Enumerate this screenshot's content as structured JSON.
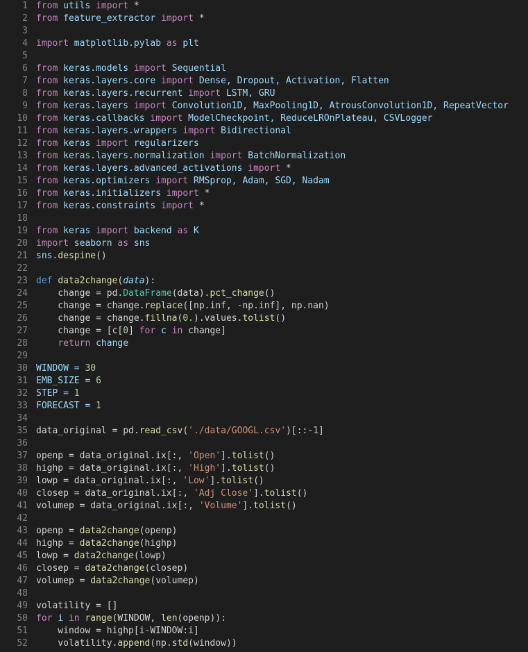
{
  "line_count": 52,
  "lines": [
    {
      "n": 1,
      "tokens": [
        {
          "t": "from ",
          "c": "kw"
        },
        {
          "t": "utils ",
          "c": "var"
        },
        {
          "t": "import ",
          "c": "kw"
        },
        {
          "t": "*",
          "c": "op"
        }
      ]
    },
    {
      "n": 2,
      "tokens": [
        {
          "t": "from ",
          "c": "kw"
        },
        {
          "t": "feature_extractor ",
          "c": "var"
        },
        {
          "t": "import ",
          "c": "kw"
        },
        {
          "t": "*",
          "c": "op"
        }
      ]
    },
    {
      "n": 3,
      "tokens": []
    },
    {
      "n": 4,
      "tokens": [
        {
          "t": "import ",
          "c": "kw"
        },
        {
          "t": "matplotlib.pylab ",
          "c": "var"
        },
        {
          "t": "as ",
          "c": "kw"
        },
        {
          "t": "plt",
          "c": "var"
        }
      ]
    },
    {
      "n": 5,
      "tokens": []
    },
    {
      "n": 6,
      "tokens": [
        {
          "t": "from ",
          "c": "kw"
        },
        {
          "t": "keras.models ",
          "c": "var"
        },
        {
          "t": "import ",
          "c": "kw"
        },
        {
          "t": "Sequential",
          "c": "var"
        }
      ]
    },
    {
      "n": 7,
      "tokens": [
        {
          "t": "from ",
          "c": "kw"
        },
        {
          "t": "keras.layers.core ",
          "c": "var"
        },
        {
          "t": "import ",
          "c": "kw"
        },
        {
          "t": "Dense, Dropout, Activation, Flatten",
          "c": "var"
        }
      ]
    },
    {
      "n": 8,
      "tokens": [
        {
          "t": "from ",
          "c": "kw"
        },
        {
          "t": "keras.layers.recurrent ",
          "c": "var"
        },
        {
          "t": "import ",
          "c": "kw"
        },
        {
          "t": "LSTM, GRU",
          "c": "var"
        }
      ]
    },
    {
      "n": 9,
      "tokens": [
        {
          "t": "from ",
          "c": "kw"
        },
        {
          "t": "keras.layers ",
          "c": "var"
        },
        {
          "t": "import ",
          "c": "kw"
        },
        {
          "t": "Convolution1D, MaxPooling1D, AtrousConvolution1D, RepeatVector",
          "c": "var"
        }
      ]
    },
    {
      "n": 10,
      "tokens": [
        {
          "t": "from ",
          "c": "kw"
        },
        {
          "t": "keras.callbacks ",
          "c": "var"
        },
        {
          "t": "import ",
          "c": "kw"
        },
        {
          "t": "ModelCheckpoint, ReduceLROnPlateau, CSVLogger",
          "c": "var"
        }
      ]
    },
    {
      "n": 11,
      "tokens": [
        {
          "t": "from ",
          "c": "kw"
        },
        {
          "t": "keras.layers.wrappers ",
          "c": "var"
        },
        {
          "t": "import ",
          "c": "kw"
        },
        {
          "t": "Bidirectional",
          "c": "var"
        }
      ]
    },
    {
      "n": 12,
      "tokens": [
        {
          "t": "from ",
          "c": "kw"
        },
        {
          "t": "keras ",
          "c": "var"
        },
        {
          "t": "import ",
          "c": "kw"
        },
        {
          "t": "regularizers",
          "c": "var"
        }
      ]
    },
    {
      "n": 13,
      "tokens": [
        {
          "t": "from ",
          "c": "kw"
        },
        {
          "t": "keras.layers.normalization ",
          "c": "var"
        },
        {
          "t": "import ",
          "c": "kw"
        },
        {
          "t": "BatchNormalization",
          "c": "var"
        }
      ]
    },
    {
      "n": 14,
      "tokens": [
        {
          "t": "from ",
          "c": "kw"
        },
        {
          "t": "keras.layers.advanced_activations ",
          "c": "var"
        },
        {
          "t": "import ",
          "c": "kw"
        },
        {
          "t": "*",
          "c": "op"
        }
      ]
    },
    {
      "n": 15,
      "tokens": [
        {
          "t": "from ",
          "c": "kw"
        },
        {
          "t": "keras.optimizers ",
          "c": "var"
        },
        {
          "t": "import ",
          "c": "kw"
        },
        {
          "t": "RMSprop, Adam, SGD, Nadam",
          "c": "var"
        }
      ]
    },
    {
      "n": 16,
      "tokens": [
        {
          "t": "from ",
          "c": "kw"
        },
        {
          "t": "keras.initializers ",
          "c": "var"
        },
        {
          "t": "import ",
          "c": "kw"
        },
        {
          "t": "*",
          "c": "op"
        }
      ]
    },
    {
      "n": 17,
      "tokens": [
        {
          "t": "from ",
          "c": "kw"
        },
        {
          "t": "keras.constraints ",
          "c": "var"
        },
        {
          "t": "import ",
          "c": "kw"
        },
        {
          "t": "*",
          "c": "op"
        }
      ]
    },
    {
      "n": 18,
      "tokens": []
    },
    {
      "n": 19,
      "tokens": [
        {
          "t": "from ",
          "c": "kw"
        },
        {
          "t": "keras ",
          "c": "var"
        },
        {
          "t": "import ",
          "c": "kw"
        },
        {
          "t": "backend ",
          "c": "var"
        },
        {
          "t": "as ",
          "c": "kw"
        },
        {
          "t": "K",
          "c": "var"
        }
      ]
    },
    {
      "n": 20,
      "tokens": [
        {
          "t": "import ",
          "c": "kw"
        },
        {
          "t": "seaborn ",
          "c": "var"
        },
        {
          "t": "as ",
          "c": "kw"
        },
        {
          "t": "sns",
          "c": "var"
        }
      ]
    },
    {
      "n": 21,
      "tokens": [
        {
          "t": "sns.",
          "c": "var"
        },
        {
          "t": "despine",
          "c": "fn"
        },
        {
          "t": "()",
          "c": "punc"
        }
      ]
    },
    {
      "n": 22,
      "tokens": []
    },
    {
      "n": 23,
      "tokens": [
        {
          "t": "def ",
          "c": "const"
        },
        {
          "t": "data2change",
          "c": "fn"
        },
        {
          "t": "(",
          "c": "punc"
        },
        {
          "t": "data",
          "c": "paramdef"
        },
        {
          "t": "):",
          "c": "punc"
        }
      ]
    },
    {
      "n": 24,
      "tokens": [
        {
          "t": "    change = pd.",
          "c": "op"
        },
        {
          "t": "DataFrame",
          "c": "type"
        },
        {
          "t": "(data).",
          "c": "op"
        },
        {
          "t": "pct_change",
          "c": "fn"
        },
        {
          "t": "()",
          "c": "punc"
        }
      ]
    },
    {
      "n": 25,
      "tokens": [
        {
          "t": "    change = change.",
          "c": "op"
        },
        {
          "t": "replace",
          "c": "fn"
        },
        {
          "t": "([np.inf, -np.inf], np.nan)",
          "c": "op"
        }
      ]
    },
    {
      "n": 26,
      "tokens": [
        {
          "t": "    change = change.",
          "c": "op"
        },
        {
          "t": "fillna",
          "c": "fn"
        },
        {
          "t": "(",
          "c": "punc"
        },
        {
          "t": "0.",
          "c": "num"
        },
        {
          "t": ").values.",
          "c": "op"
        },
        {
          "t": "tolist",
          "c": "fn"
        },
        {
          "t": "()",
          "c": "punc"
        }
      ]
    },
    {
      "n": 27,
      "tokens": [
        {
          "t": "    change = [c[",
          "c": "op"
        },
        {
          "t": "0",
          "c": "num"
        },
        {
          "t": "] ",
          "c": "op"
        },
        {
          "t": "for ",
          "c": "kw"
        },
        {
          "t": "c ",
          "c": "var"
        },
        {
          "t": "in ",
          "c": "kw"
        },
        {
          "t": "change]",
          "c": "op"
        }
      ]
    },
    {
      "n": 28,
      "tokens": [
        {
          "t": "    ",
          "c": "op"
        },
        {
          "t": "return ",
          "c": "kw"
        },
        {
          "t": "change",
          "c": "var"
        }
      ]
    },
    {
      "n": 29,
      "tokens": []
    },
    {
      "n": 30,
      "tokens": [
        {
          "t": "WINDOW = ",
          "c": "var"
        },
        {
          "t": "30",
          "c": "num"
        }
      ]
    },
    {
      "n": 31,
      "tokens": [
        {
          "t": "EMB_SIZE = ",
          "c": "var"
        },
        {
          "t": "6",
          "c": "num"
        }
      ]
    },
    {
      "n": 32,
      "tokens": [
        {
          "t": "STEP = ",
          "c": "var"
        },
        {
          "t": "1",
          "c": "num"
        }
      ]
    },
    {
      "n": 33,
      "tokens": [
        {
          "t": "FORECAST = ",
          "c": "var"
        },
        {
          "t": "1",
          "c": "num"
        }
      ]
    },
    {
      "n": 34,
      "tokens": []
    },
    {
      "n": 35,
      "tokens": [
        {
          "t": "data_original = pd.",
          "c": "op"
        },
        {
          "t": "read_csv",
          "c": "fn"
        },
        {
          "t": "(",
          "c": "punc"
        },
        {
          "t": "'./data/GOOGL.csv'",
          "c": "str"
        },
        {
          "t": ")[::-",
          "c": "op"
        },
        {
          "t": "1",
          "c": "num"
        },
        {
          "t": "]",
          "c": "op"
        }
      ]
    },
    {
      "n": 36,
      "tokens": []
    },
    {
      "n": 37,
      "tokens": [
        {
          "t": "openp = data_original.ix[:, ",
          "c": "op"
        },
        {
          "t": "'Open'",
          "c": "str"
        },
        {
          "t": "].",
          "c": "op"
        },
        {
          "t": "tolist",
          "c": "fn"
        },
        {
          "t": "()",
          "c": "punc"
        }
      ]
    },
    {
      "n": 38,
      "tokens": [
        {
          "t": "highp = data_original.ix[:, ",
          "c": "op"
        },
        {
          "t": "'High'",
          "c": "str"
        },
        {
          "t": "].",
          "c": "op"
        },
        {
          "t": "tolist",
          "c": "fn"
        },
        {
          "t": "()",
          "c": "punc"
        }
      ]
    },
    {
      "n": 39,
      "tokens": [
        {
          "t": "lowp = data_original.ix[:, ",
          "c": "op"
        },
        {
          "t": "'Low'",
          "c": "str"
        },
        {
          "t": "].",
          "c": "op"
        },
        {
          "t": "tolist",
          "c": "fn"
        },
        {
          "t": "()",
          "c": "punc"
        }
      ]
    },
    {
      "n": 40,
      "tokens": [
        {
          "t": "closep = data_original.ix[:, ",
          "c": "op"
        },
        {
          "t": "'Adj Close'",
          "c": "str"
        },
        {
          "t": "].",
          "c": "op"
        },
        {
          "t": "tolist",
          "c": "fn"
        },
        {
          "t": "()",
          "c": "punc"
        }
      ]
    },
    {
      "n": 41,
      "tokens": [
        {
          "t": "volumep = data_original.ix[:, ",
          "c": "op"
        },
        {
          "t": "'Volume'",
          "c": "str"
        },
        {
          "t": "].",
          "c": "op"
        },
        {
          "t": "tolist",
          "c": "fn"
        },
        {
          "t": "()",
          "c": "punc"
        }
      ]
    },
    {
      "n": 42,
      "tokens": []
    },
    {
      "n": 43,
      "tokens": [
        {
          "t": "openp = ",
          "c": "op"
        },
        {
          "t": "data2change",
          "c": "fn"
        },
        {
          "t": "(openp)",
          "c": "op"
        }
      ]
    },
    {
      "n": 44,
      "tokens": [
        {
          "t": "highp = ",
          "c": "op"
        },
        {
          "t": "data2change",
          "c": "fn"
        },
        {
          "t": "(highp)",
          "c": "op"
        }
      ]
    },
    {
      "n": 45,
      "tokens": [
        {
          "t": "lowp = ",
          "c": "op"
        },
        {
          "t": "data2change",
          "c": "fn"
        },
        {
          "t": "(lowp)",
          "c": "op"
        }
      ]
    },
    {
      "n": 46,
      "tokens": [
        {
          "t": "closep = ",
          "c": "op"
        },
        {
          "t": "data2change",
          "c": "fn"
        },
        {
          "t": "(closep)",
          "c": "op"
        }
      ]
    },
    {
      "n": 47,
      "tokens": [
        {
          "t": "volumep = ",
          "c": "op"
        },
        {
          "t": "data2change",
          "c": "fn"
        },
        {
          "t": "(volumep)",
          "c": "op"
        }
      ]
    },
    {
      "n": 48,
      "tokens": []
    },
    {
      "n": 49,
      "tokens": [
        {
          "t": "volatility = []",
          "c": "op"
        }
      ]
    },
    {
      "n": 50,
      "tokens": [
        {
          "t": "for ",
          "c": "kw"
        },
        {
          "t": "i ",
          "c": "var"
        },
        {
          "t": "in ",
          "c": "kw"
        },
        {
          "t": "range",
          "c": "fn"
        },
        {
          "t": "(WINDOW, ",
          "c": "op"
        },
        {
          "t": "len",
          "c": "fn"
        },
        {
          "t": "(openp)):",
          "c": "op"
        }
      ]
    },
    {
      "n": 51,
      "tokens": [
        {
          "t": "    window = highp[i-WINDOW:i]",
          "c": "op"
        }
      ]
    },
    {
      "n": 52,
      "tokens": [
        {
          "t": "    volatility.",
          "c": "op"
        },
        {
          "t": "append",
          "c": "fn"
        },
        {
          "t": "(np.",
          "c": "op"
        },
        {
          "t": "std",
          "c": "fn"
        },
        {
          "t": "(window))",
          "c": "op"
        }
      ]
    }
  ]
}
